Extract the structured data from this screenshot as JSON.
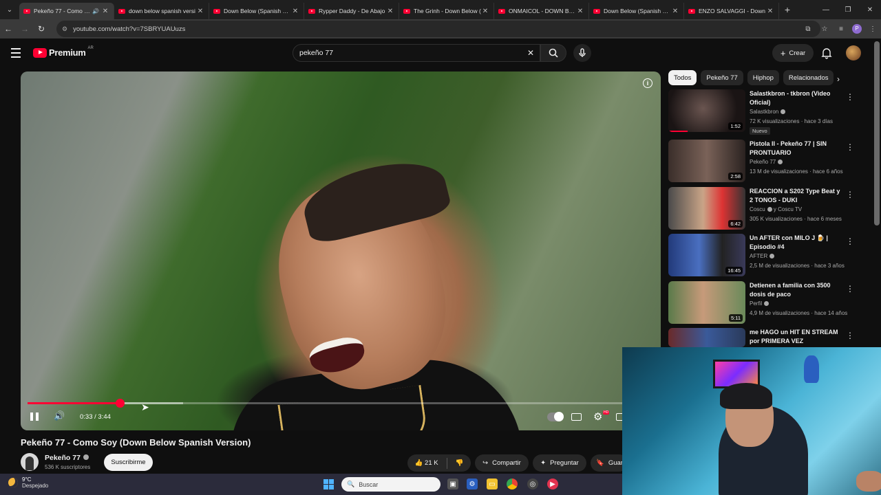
{
  "browser": {
    "tabs": [
      {
        "title": "Pekeño 77 - Como Soy",
        "active": true
      },
      {
        "title": "down below spanish versi"
      },
      {
        "title": "Down Below (Spanish Ver"
      },
      {
        "title": "Rypper Daddy - De Abajo"
      },
      {
        "title": "The Grinh - Down Below ("
      },
      {
        "title": "ONMAICOL - DOWN BELO"
      },
      {
        "title": "Down Below (Spanish Ver"
      },
      {
        "title": "ENZO SALVAGGI - Down"
      }
    ],
    "url": "youtube.com/watch?v=7SBRYUAUuzs",
    "profile_initial": "P"
  },
  "youtube": {
    "logo_text": "Premium",
    "country_code": "AR",
    "search_value": "pekeño 77",
    "create_label": "Crear"
  },
  "player": {
    "current_time": "0:33",
    "duration": "3:44",
    "time_separator": " / ",
    "progress_fraction": 0.147,
    "buffered_fraction": 0.248
  },
  "video": {
    "title": "Pekeño 77 - Como Soy (Down Below Spanish Version)",
    "channel": "Pekeño 77",
    "subscribers": "536 K suscriptores",
    "subscribe_label": "Suscribirme",
    "likes": "21 K",
    "share_label": "Compartir",
    "ask_label": "Preguntar",
    "save_label": "Guar"
  },
  "chips": [
    "Todos",
    "Pekeño 77",
    "Hiphop",
    "Relacionados"
  ],
  "recommendations": [
    {
      "title": "Salastkbron - tkbron (Video Oficial)",
      "channel": "Salastkbron",
      "verified": true,
      "meta": "72 K visualizaciones · hace 3 días",
      "duration": "1:52",
      "badge": "Nuevo",
      "watched": 0.25
    },
    {
      "title": "Pistola II - Pekeño 77 | SIN PRONTUARIO",
      "channel": "Pekeño 77",
      "verified": true,
      "meta": "13 M de visualizaciones · hace 6 años",
      "duration": "2:58",
      "badge": "",
      "watched": 0
    },
    {
      "title": "REACCION a S202 Type Beat y 2 TONOS - DUKI",
      "channel": "Coscu",
      "channel_extra": "y Coscu TV",
      "verified": true,
      "meta": "305 K visualizaciones · hace 6 meses",
      "duration": "6:42",
      "badge": "",
      "watched": 0
    },
    {
      "title": "Un AFTER con MILO J 🍺 | Episodio #4",
      "channel": "AFTER",
      "verified": true,
      "meta": "2,5 M de visualizaciones · hace 3 años",
      "duration": "16:45",
      "badge": "",
      "watched": 0
    },
    {
      "title": "Detienen a familia con 3500 dosis de paco",
      "channel": "Perfil",
      "verified": true,
      "meta": "4,9 M de visualizaciones · hace 14 años",
      "duration": "5:11",
      "badge": "",
      "watched": 0
    },
    {
      "title": "me HAGO un HIT EN STREAM por PRIMERA VEZ",
      "channel": "",
      "verified": false,
      "meta": "",
      "duration": "",
      "badge": "",
      "watched": 0
    }
  ],
  "taskbar": {
    "temperature": "9°C",
    "weather": "Despejado",
    "search_placeholder": "Buscar"
  },
  "colors": {
    "accent": "#ff0033",
    "background": "#0f0f0f",
    "chip_bg": "#272727"
  }
}
